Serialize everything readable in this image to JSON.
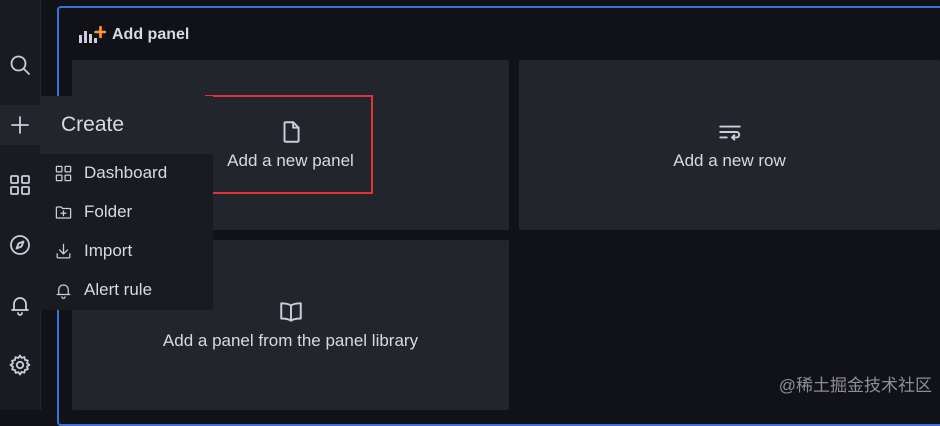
{
  "sidebar": {
    "icons": [
      "search-icon",
      "plus-icon",
      "dashboards-icon",
      "compass-icon",
      "bell-icon",
      "gear-icon"
    ]
  },
  "create_menu": {
    "title": "Create",
    "items": [
      {
        "label": "Dashboard",
        "icon": "apps-icon"
      },
      {
        "label": "Folder",
        "icon": "folder-plus-icon"
      },
      {
        "label": "Import",
        "icon": "import-icon"
      },
      {
        "label": "Alert rule",
        "icon": "bell-icon"
      }
    ]
  },
  "add_panel": {
    "header": "Add panel",
    "options": [
      {
        "label": "Add a new panel",
        "icon": "file-icon"
      },
      {
        "label": "Add a new row",
        "icon": "rows-icon"
      },
      {
        "label": "Add a panel from the panel library",
        "icon": "book-icon"
      }
    ]
  },
  "watermark": "@稀土掘金技术社区",
  "colors": {
    "accent": "#3d71d9",
    "highlight": "#e0333f",
    "panel_bg": "#22252b",
    "bg": "#111217"
  }
}
